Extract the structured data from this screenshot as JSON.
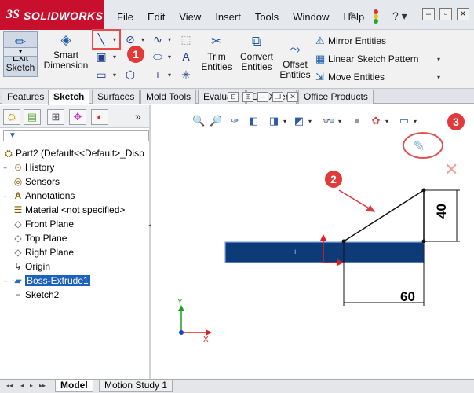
{
  "app": {
    "logo_ds": "3S",
    "logo_text": "SOLIDWORKS"
  },
  "menu": [
    "File",
    "Edit",
    "View",
    "Insert",
    "Tools",
    "Window",
    "Help"
  ],
  "window_controls": {
    "minimize": "–",
    "restore": "▫",
    "close": "✕"
  },
  "help_label": "?",
  "ribbon": {
    "exit_sketch": "Exit Sketch",
    "smart_dimension": "Smart Dimension",
    "trim_entities": "Trim Entities",
    "convert_entities": "Convert Entities",
    "offset_entities": "Offset Entities",
    "mirror_entities": "Mirror Entities",
    "linear_sketch_pattern": "Linear Sketch Pattern",
    "move_entities": "Move Entities"
  },
  "callouts": {
    "one": "1",
    "two": "2",
    "three": "3"
  },
  "tabs": [
    "Features",
    "Sketch",
    "Surfaces",
    "Mold Tools",
    "Evaluate",
    "DimXpert",
    "Office Products"
  ],
  "active_tab": "Sketch",
  "tree": [
    {
      "label": "Part2  (Default<<Default>_Disp",
      "icon": "part-icon",
      "expand": ""
    },
    {
      "label": "History",
      "icon": "history-icon",
      "expand": "+"
    },
    {
      "label": "Sensors",
      "icon": "sensor-icon",
      "expand": ""
    },
    {
      "label": "Annotations",
      "icon": "annotations-icon",
      "expand": "+"
    },
    {
      "label": "Material <not specified>",
      "icon": "material-icon",
      "expand": ""
    },
    {
      "label": "Front Plane",
      "icon": "plane-icon",
      "expand": ""
    },
    {
      "label": "Top Plane",
      "icon": "plane-icon",
      "expand": ""
    },
    {
      "label": "Right Plane",
      "icon": "plane-icon",
      "expand": ""
    },
    {
      "label": "Origin",
      "icon": "origin-icon",
      "expand": ""
    },
    {
      "label": "Boss-Extrude1",
      "icon": "boss-extrude-icon",
      "expand": "+"
    },
    {
      "label": "Sketch2",
      "icon": "sketch-icon",
      "expand": ""
    }
  ],
  "dimensions": {
    "horizontal": "60",
    "vertical": "40"
  },
  "bottom_tabs": [
    "Model",
    "Motion Study 1"
  ],
  "colors": {
    "accent": "#1c62bd",
    "callout": "#e03a3a",
    "brand": "#c8102e",
    "extrude_fill": "#0d3b78"
  }
}
